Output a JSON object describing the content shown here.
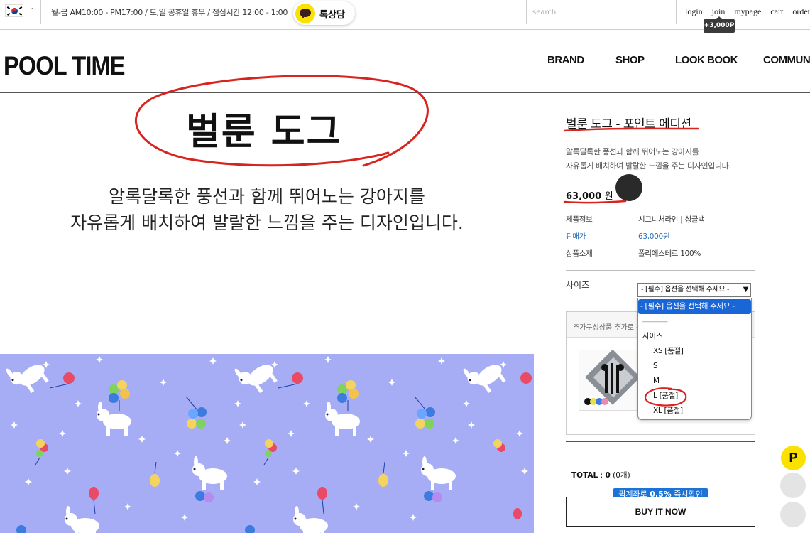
{
  "topbar": {
    "hours": "월-금 AM10:00 - PM17:00  /  토,일 공휴일 휴무  /  점심시간 12:00 - 1:00",
    "kakao_label": "톡상담",
    "search_placeholder": "search",
    "links": [
      "login",
      "join",
      "mypage",
      "cart",
      "order"
    ],
    "points_badge": "+3,000P"
  },
  "header": {
    "logo": "POOL TIME",
    "nav": [
      "BRAND",
      "SHOP",
      "LOOK BOOK",
      "COMMUNITY"
    ]
  },
  "hero": {
    "title": "벌룬 도그",
    "desc_line1": "알록달록한 풍선과 함께 뛰어노는 강아지를",
    "desc_line2": "자유롭게 배치하여 발랄한 느낌을 주는 디자인입니다."
  },
  "product": {
    "title": "벌룬 도그 - 포인트 에디션",
    "desc_line1": "알록달록한 풍선과 함께 뛰어노는 강아지를",
    "desc_line2": "자유롭게 배치하여 발랄한 느낌을 주는 디자인입니다.",
    "price": "63,000",
    "price_unit": "원",
    "info": [
      {
        "key": "제품정보",
        "value": "시그니처라인 | 싱글백"
      },
      {
        "key": "판매가",
        "value": "63,000원"
      },
      {
        "key": "상품소재",
        "value": "폴리에스테르 100%"
      }
    ],
    "size_label": "사이즈",
    "size_selected": "- [필수] 옵션을 선택해 주세요 -",
    "dropdown": {
      "selected": "- [필수] 옵션을 선택해 주세요 -",
      "divider": "-------------------",
      "group": "사이즈",
      "options": [
        "XS [품절]",
        "S",
        "M",
        "L [품절]",
        "XL [품절]"
      ]
    },
    "addon_head": "추가구성상품 추가로 구매하시면 좋아요",
    "total_label": "TOTAL",
    "total_value": "0",
    "total_count": "(0개)",
    "discount_prefix": "퀵계좌로 ",
    "discount_rate": "0.5%",
    "discount_suffix": " 즉시할인",
    "buy_label": "BUY IT NOW"
  },
  "floating": {
    "point_icon_label": "P"
  },
  "colors": {
    "accent_blue": "#1d72d6",
    "kakao_yellow": "#fae100",
    "annotation_red": "#d8241f",
    "pattern_bg": "#a7adf5"
  }
}
